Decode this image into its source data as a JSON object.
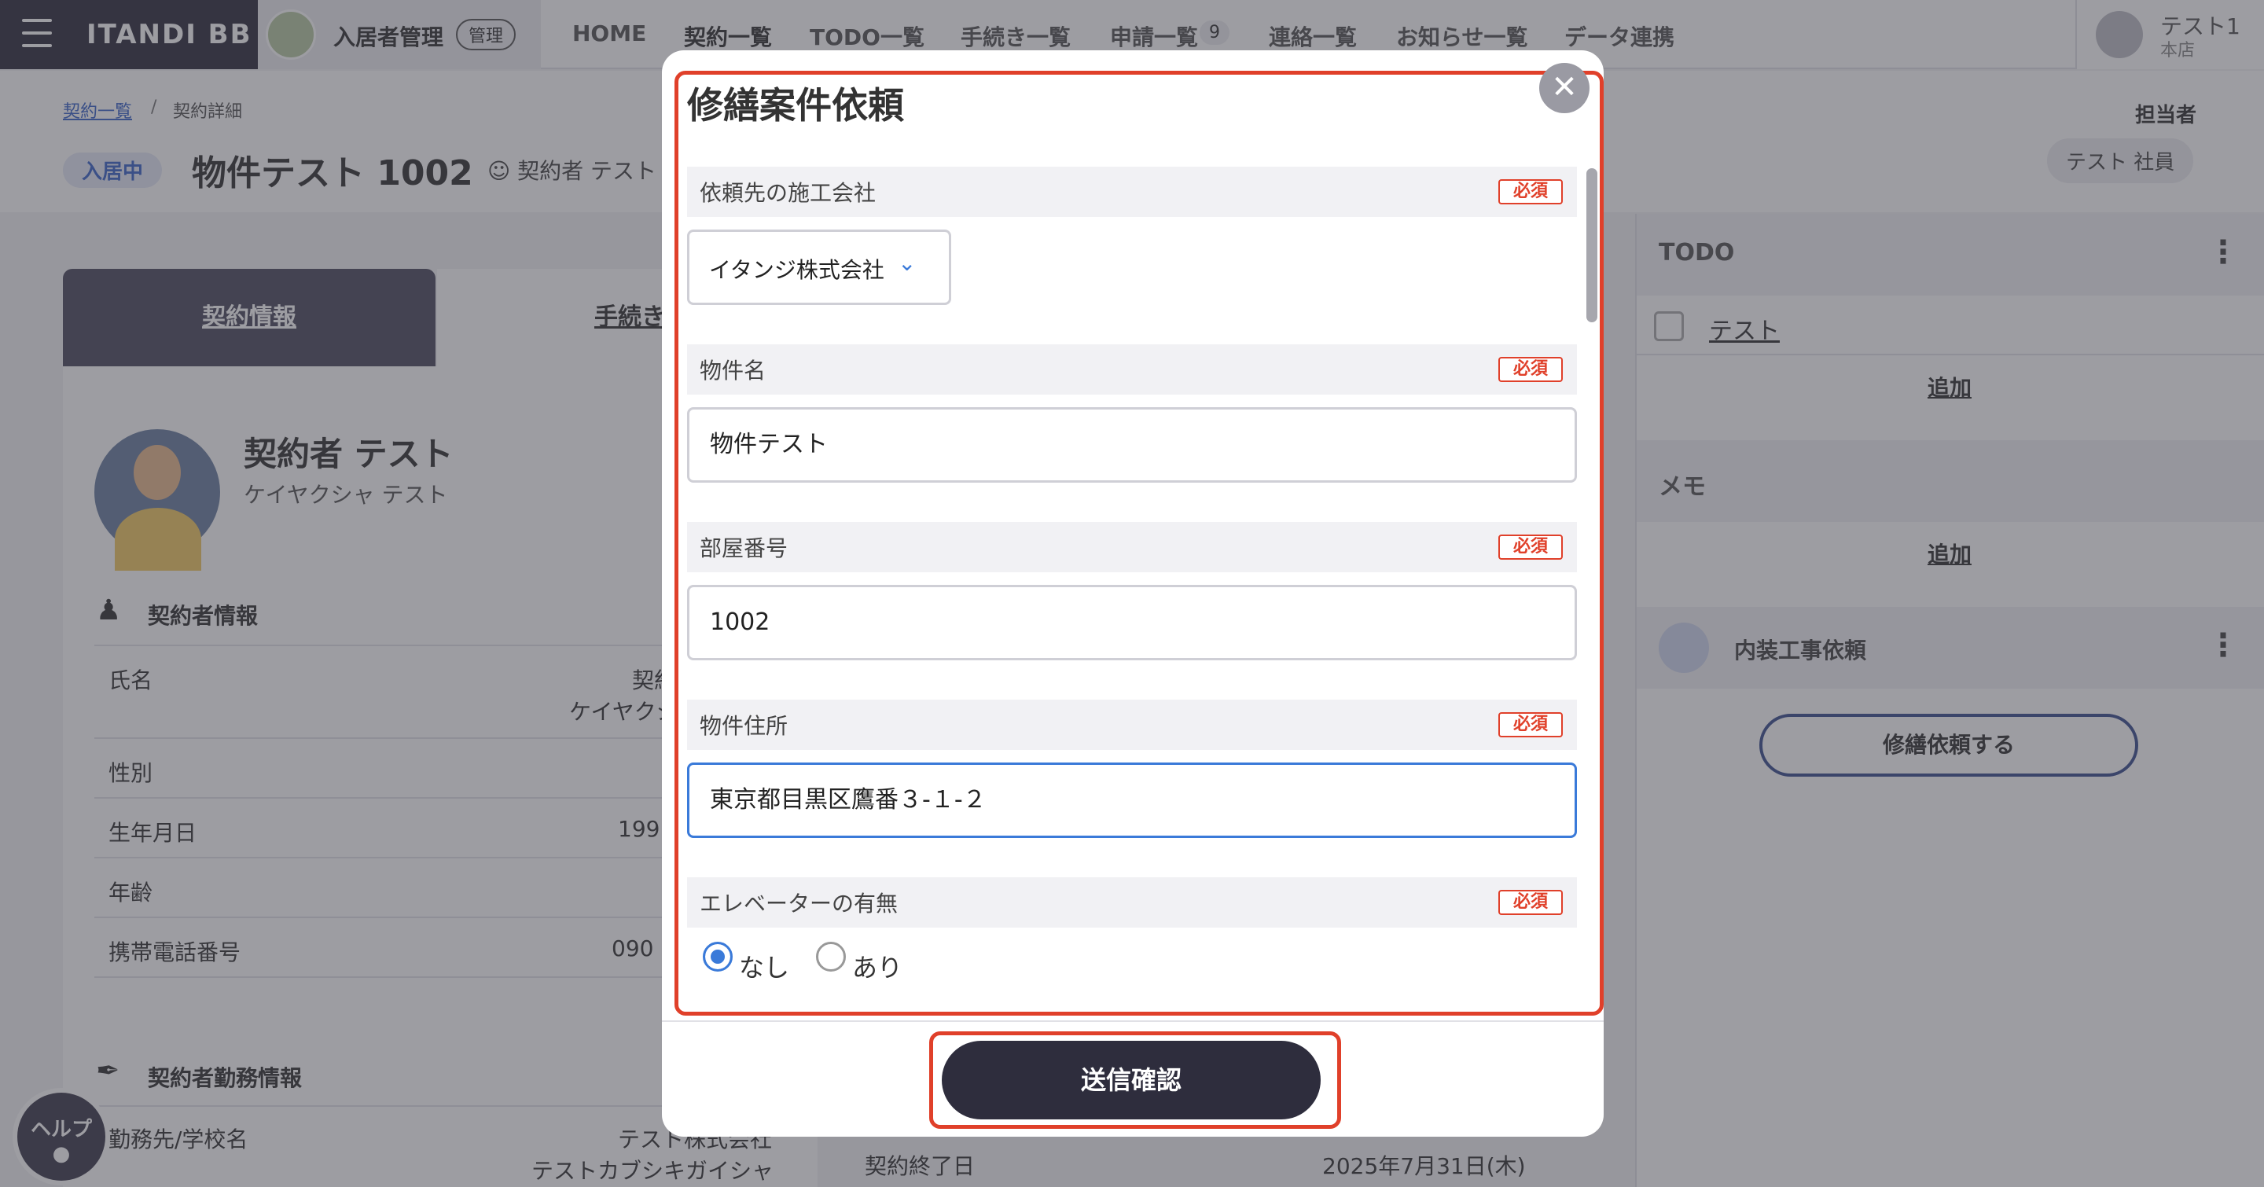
{
  "topbar": {
    "logo": "ITANDI BB",
    "app_label": "入居者管理",
    "app_badge": "管理",
    "nav": [
      "HOME",
      "契約一覧",
      "TODO一覧",
      "手続き一覧",
      "申請一覧",
      "連絡一覧",
      "お知らせ一覧",
      "データ連携"
    ],
    "nav_count": "9",
    "user_name": "テスト1",
    "user_branch": "本店"
  },
  "header": {
    "breadcrumb": [
      "契約一覧",
      "契約詳細"
    ],
    "breadcrumb_sep": "/",
    "status": "入居中",
    "title": "物件テスト 1002",
    "contractor": "契約者 テスト",
    "assignee_label": "担当者",
    "assignee": "テスト 社員"
  },
  "left": {
    "tabs": [
      "契約情報",
      "手続き"
    ],
    "person_name": "契約者 テスト",
    "person_kana": "ケイヤクシャ テスト",
    "section_info": "契約者情報",
    "rows": [
      {
        "label": "氏名",
        "value": "契約",
        "value2": "ケイヤクシ"
      },
      {
        "label": "性別",
        "value": ""
      },
      {
        "label": "生年月日",
        "value": "199"
      },
      {
        "label": "年齢",
        "value": ""
      },
      {
        "label": "携帯電話番号",
        "value": "090"
      }
    ],
    "section_work": "契約者勤務情報",
    "work_label": "勤務先/学校名",
    "work_value": "テスト株式会社",
    "work_value2": "テストカブシキガイシャ"
  },
  "contract_end": {
    "label": "契約終了日",
    "value": "2025年7月31日(木)"
  },
  "right": {
    "todo_title": "TODO",
    "todo_item": "テスト",
    "add": "追加",
    "memo_title": "メモ",
    "repair_label": "内装工事依頼",
    "repair_button": "修繕依頼する"
  },
  "help": "ヘルプ",
  "modal": {
    "title": "修繕案件依頼",
    "close": "✕",
    "required": "必須",
    "fields": {
      "company": {
        "label": "依頼先の施工会社",
        "value": "イタンジ株式会社"
      },
      "property": {
        "label": "物件名",
        "value": "物件テスト"
      },
      "room": {
        "label": "部屋番号",
        "value": "1002"
      },
      "address": {
        "label": "物件住所",
        "value": "東京都目黒区鷹番３-１-２"
      },
      "elevator": {
        "label": "エレベーターの有無",
        "options": [
          "なし",
          "あり"
        ],
        "selected": "なし"
      }
    },
    "submit": "送信確認"
  },
  "colors": {
    "accent": "#3a7ad9",
    "highlight": "#e0402a",
    "dark": "#2e2d3d"
  }
}
